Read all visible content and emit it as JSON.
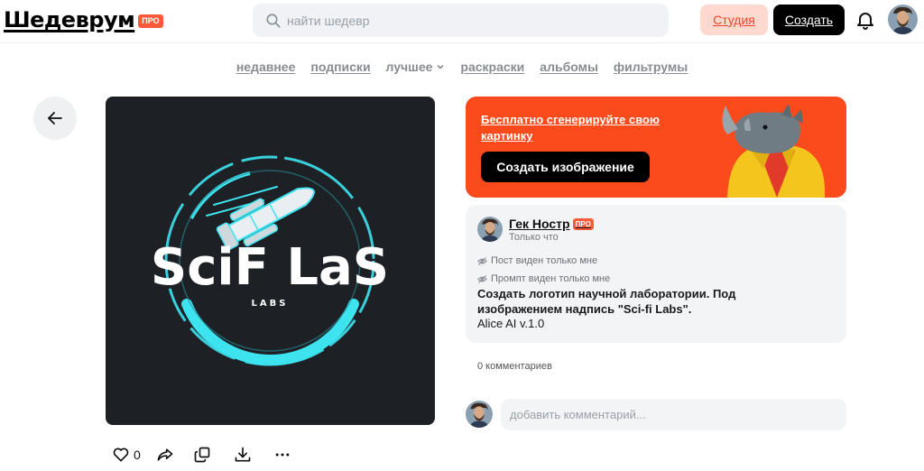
{
  "header": {
    "logo": "Шедеврум",
    "pro_badge": "ПРО",
    "search_placeholder": "найти шедевр",
    "studio_label": "Студия",
    "create_label": "Создать"
  },
  "nav": {
    "items": [
      {
        "label": "недавнее"
      },
      {
        "label": "подписки"
      },
      {
        "label": "лучшее"
      },
      {
        "label": "раскраски"
      },
      {
        "label": "альбомы"
      },
      {
        "label": "фильтрумы"
      }
    ]
  },
  "artwork": {
    "title_text": "SciF LaS",
    "subtitle_text": "LABS"
  },
  "actions": {
    "likes": "0"
  },
  "promo": {
    "text": "Бесплатно сгенерируйте свою картинку",
    "button": "Создать изображение"
  },
  "post": {
    "author": "Гек Нострl",
    "author_display": "Гек Ностр",
    "pro_badge": "ПРО",
    "time": "Только что",
    "post_visibility": "Пост виден только мне",
    "prompt_visibility": "Промпт виден только мне",
    "prompt": "Создать логотип научной лаборатории. Под изображением надпись \"Sci-fi Labs\".",
    "model": "Alice AI v.1.0"
  },
  "comments": {
    "count_text": "0 комментариев",
    "input_placeholder": "добавить комментарий..."
  },
  "colors": {
    "accent": "#fb4a1c",
    "brand_red": "#f0442a",
    "art_bg": "#1d2024",
    "cyan": "#3ee3f0"
  }
}
